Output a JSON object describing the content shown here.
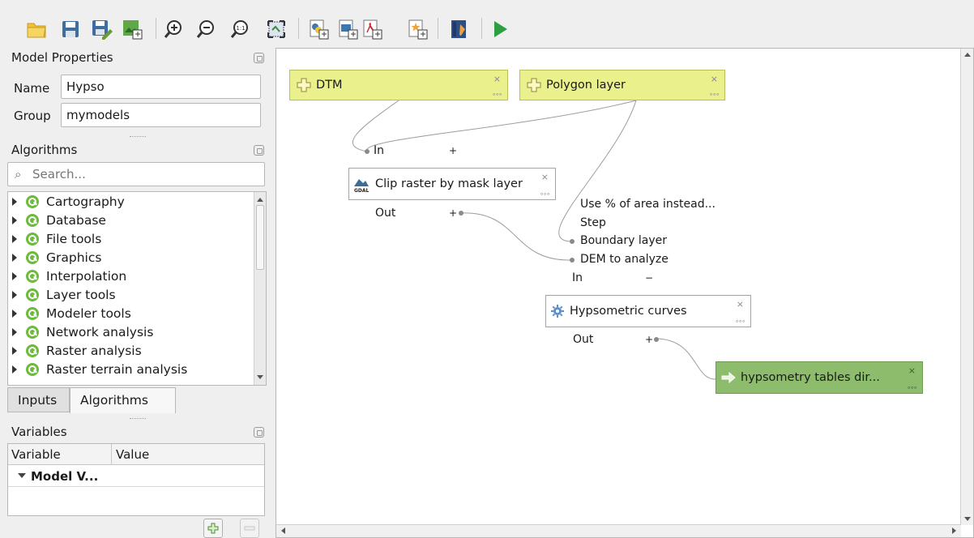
{
  "model_properties": {
    "title": "Model Properties",
    "name_label": "Name",
    "name_value": "Hypso",
    "group_label": "Group",
    "group_value": "mymodels"
  },
  "algorithms": {
    "title": "Algorithms",
    "search_placeholder": "Search...",
    "items": [
      {
        "label": "Cartography"
      },
      {
        "label": "Database"
      },
      {
        "label": "File tools"
      },
      {
        "label": "Graphics"
      },
      {
        "label": "Interpolation"
      },
      {
        "label": "Layer tools"
      },
      {
        "label": "Modeler tools"
      },
      {
        "label": "Network analysis"
      },
      {
        "label": "Raster analysis"
      },
      {
        "label": "Raster terrain analysis"
      }
    ]
  },
  "tabs": [
    {
      "label": "Inputs"
    },
    {
      "label": "Algorithms"
    }
  ],
  "variables": {
    "title": "Variables",
    "col_variable": "Variable",
    "col_value": "Value",
    "group_row": "Model V..."
  },
  "canvas": {
    "nodes": {
      "dtm": {
        "label": "DTM"
      },
      "polygon": {
        "label": "Polygon layer"
      },
      "clip": {
        "label": "Clip raster by mask layer"
      },
      "hypso": {
        "label": "Hypsometric curves"
      },
      "output": {
        "label": "hypsometry tables dir..."
      }
    },
    "ports": {
      "clip_in": "In",
      "clip_out": "Out",
      "hypso_param1": "Use % of area instead...",
      "hypso_param2": "Step",
      "hypso_param3": "Boundary layer",
      "hypso_param4": "DEM to analyze",
      "hypso_in": "In",
      "hypso_out": "Out"
    },
    "symbols": {
      "plus": "+",
      "minus": "−",
      "close": "⨯",
      "more": "∘∘∘"
    }
  },
  "colors": {
    "input_node": "#e9f08c",
    "output_node": "#8dbd6c",
    "run_green": "#2e9e43",
    "wire": "#9c9c9c"
  }
}
